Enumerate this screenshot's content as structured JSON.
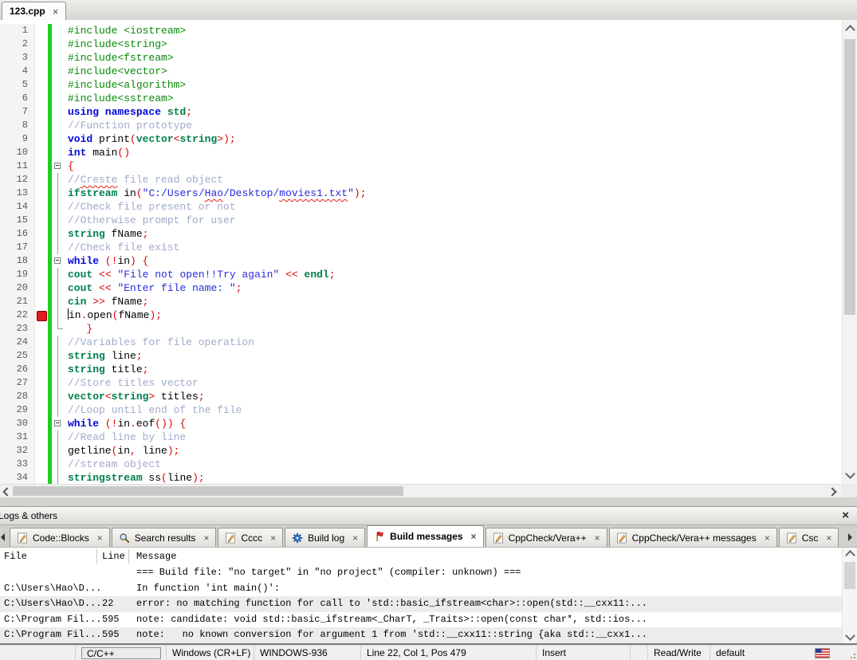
{
  "glyphs": {
    "close": "×"
  },
  "colors": {
    "changebar_green": "#1fcd1f",
    "breakpoint_red": "#e41b1b",
    "keyword_blue": "#0008d7",
    "stdlib_green": "#00804b",
    "preprocessor_green": "#078907",
    "string_blue": "#2a2adf",
    "operator_red": "#de0000",
    "comment_gray_blue": "#9fabcb"
  },
  "editor": {
    "tab": {
      "label": "123.cpp"
    },
    "lines": [
      {
        "n": 1,
        "s": [
          [
            "pp",
            "#include <iostream>"
          ]
        ]
      },
      {
        "n": 2,
        "s": [
          [
            "pp",
            "#include<string>"
          ]
        ]
      },
      {
        "n": 3,
        "s": [
          [
            "pp",
            "#include<fstream>"
          ]
        ]
      },
      {
        "n": 4,
        "s": [
          [
            "pp",
            "#include<vector>"
          ]
        ]
      },
      {
        "n": 5,
        "s": [
          [
            "pp",
            "#include<algorithm>"
          ]
        ]
      },
      {
        "n": 6,
        "s": [
          [
            "pp",
            "#include<sstream>"
          ]
        ]
      },
      {
        "n": 7,
        "s": [
          [
            "kw",
            "using namespace"
          ],
          [
            "id",
            " "
          ],
          [
            "lib",
            "std"
          ],
          [
            "op",
            ";"
          ]
        ]
      },
      {
        "n": 8,
        "s": [
          [
            "com",
            "//Function prototype"
          ]
        ]
      },
      {
        "n": 9,
        "s": [
          [
            "kw",
            "void"
          ],
          [
            "id",
            " print"
          ],
          [
            "op",
            "("
          ],
          [
            "lib",
            "vector"
          ],
          [
            "op",
            "<"
          ],
          [
            "lib",
            "string"
          ],
          [
            "op",
            ">);"
          ]
        ]
      },
      {
        "n": 10,
        "s": [
          [
            "kw",
            "int"
          ],
          [
            "id",
            " main"
          ],
          [
            "op",
            "()"
          ]
        ]
      },
      {
        "n": 11,
        "fold": "box",
        "s": [
          [
            "op",
            "{"
          ]
        ]
      },
      {
        "n": 12,
        "fold": "line",
        "s": [
          [
            "com",
            "//"
          ],
          [
            "com sq",
            "Creste"
          ],
          [
            "com",
            " file read object"
          ]
        ]
      },
      {
        "n": 13,
        "fold": "line",
        "s": [
          [
            "lib",
            "ifstream"
          ],
          [
            "id",
            " in"
          ],
          [
            "op",
            "("
          ],
          [
            "str",
            "\"C:/Users/"
          ],
          [
            "str sq",
            "Hao"
          ],
          [
            "str",
            "/Desktop/"
          ],
          [
            "str sq",
            "movies1.txt"
          ],
          [
            "str",
            "\""
          ],
          [
            "op",
            ");"
          ]
        ]
      },
      {
        "n": 14,
        "fold": "line",
        "s": [
          [
            "com",
            "//Check file present or not"
          ]
        ]
      },
      {
        "n": 15,
        "fold": "line",
        "s": [
          [
            "com",
            "//Otherwise prompt for user"
          ]
        ]
      },
      {
        "n": 16,
        "fold": "line",
        "s": [
          [
            "lib",
            "string"
          ],
          [
            "id",
            " fName"
          ],
          [
            "op",
            ";"
          ]
        ]
      },
      {
        "n": 17,
        "fold": "line",
        "s": [
          [
            "com",
            "//Check file exist"
          ]
        ]
      },
      {
        "n": 18,
        "fold": "box",
        "s": [
          [
            "kw",
            "while"
          ],
          [
            "id",
            " "
          ],
          [
            "op",
            "(!"
          ],
          [
            "id",
            "in"
          ],
          [
            "op",
            ")"
          ],
          [
            "id",
            " "
          ],
          [
            "op",
            "{"
          ]
        ]
      },
      {
        "n": 19,
        "fold": "line",
        "s": [
          [
            "lib",
            "cout"
          ],
          [
            "id",
            " "
          ],
          [
            "op",
            "<<"
          ],
          [
            "id",
            " "
          ],
          [
            "str",
            "\"File not open!!Try again\""
          ],
          [
            "id",
            " "
          ],
          [
            "op",
            "<<"
          ],
          [
            "id",
            " "
          ],
          [
            "lib",
            "endl"
          ],
          [
            "op",
            ";"
          ]
        ]
      },
      {
        "n": 20,
        "fold": "line",
        "s": [
          [
            "lib",
            "cout"
          ],
          [
            "id",
            " "
          ],
          [
            "op",
            "<<"
          ],
          [
            "id",
            " "
          ],
          [
            "str",
            "\"Enter file name: \""
          ],
          [
            "op",
            ";"
          ]
        ]
      },
      {
        "n": 21,
        "fold": "line",
        "s": [
          [
            "lib",
            "cin"
          ],
          [
            "id",
            " "
          ],
          [
            "op",
            ">>"
          ],
          [
            "id",
            " fName"
          ],
          [
            "op",
            ";"
          ]
        ]
      },
      {
        "n": 22,
        "fold": "line",
        "bp": true,
        "caret": true,
        "s": [
          [
            "id",
            "in"
          ],
          [
            "op",
            "."
          ],
          [
            "id",
            "open"
          ],
          [
            "op",
            "("
          ],
          [
            "id",
            "fName"
          ],
          [
            "op",
            ");"
          ]
        ]
      },
      {
        "n": 23,
        "fold": "end",
        "s": [
          [
            "id",
            "   "
          ],
          [
            "op",
            "}"
          ]
        ]
      },
      {
        "n": 24,
        "fold": "line",
        "s": [
          [
            "com",
            "//Variables for file operation"
          ]
        ]
      },
      {
        "n": 25,
        "fold": "line",
        "s": [
          [
            "lib",
            "string"
          ],
          [
            "id",
            " line"
          ],
          [
            "op",
            ";"
          ]
        ]
      },
      {
        "n": 26,
        "fold": "line",
        "s": [
          [
            "lib",
            "string"
          ],
          [
            "id",
            " title"
          ],
          [
            "op",
            ";"
          ]
        ]
      },
      {
        "n": 27,
        "fold": "line",
        "s": [
          [
            "com",
            "//Store titles vector"
          ]
        ]
      },
      {
        "n": 28,
        "fold": "line",
        "s": [
          [
            "lib",
            "vector"
          ],
          [
            "op",
            "<"
          ],
          [
            "lib",
            "string"
          ],
          [
            "op",
            ">"
          ],
          [
            "id",
            " titles"
          ],
          [
            "op",
            ";"
          ]
        ]
      },
      {
        "n": 29,
        "fold": "line",
        "s": [
          [
            "com",
            "//Loop until end of the file"
          ]
        ]
      },
      {
        "n": 30,
        "fold": "box",
        "s": [
          [
            "kw",
            "while"
          ],
          [
            "id",
            " "
          ],
          [
            "op",
            "(!"
          ],
          [
            "id",
            "in"
          ],
          [
            "op",
            "."
          ],
          [
            "id",
            "eof"
          ],
          [
            "op",
            "())"
          ],
          [
            "id",
            " "
          ],
          [
            "op",
            "{"
          ]
        ]
      },
      {
        "n": 31,
        "fold": "line",
        "s": [
          [
            "com",
            "//Read line by line"
          ]
        ]
      },
      {
        "n": 32,
        "fold": "line",
        "s": [
          [
            "id",
            "getline"
          ],
          [
            "op",
            "("
          ],
          [
            "id",
            "in"
          ],
          [
            "op",
            ","
          ],
          [
            "id",
            " line"
          ],
          [
            "op",
            ");"
          ]
        ]
      },
      {
        "n": 33,
        "fold": "line",
        "s": [
          [
            "com",
            "//stream object"
          ]
        ]
      },
      {
        "n": 34,
        "fold": "line",
        "s": [
          [
            "lib",
            "stringstream"
          ],
          [
            "id",
            " ss"
          ],
          [
            "op",
            "("
          ],
          [
            "id",
            "line"
          ],
          [
            "op",
            ");"
          ]
        ]
      }
    ]
  },
  "logs": {
    "caption": "Logs & others",
    "tabs": [
      {
        "label": "Code::Blocks",
        "icon": "report-icon",
        "active": false
      },
      {
        "label": "Search results",
        "icon": "search-icon",
        "active": false
      },
      {
        "label": "Cccc",
        "icon": "report-icon",
        "active": false
      },
      {
        "label": "Build log",
        "icon": "gear-icon",
        "active": false
      },
      {
        "label": "Build messages",
        "icon": "flag-icon",
        "active": true
      },
      {
        "label": "CppCheck/Vera++",
        "icon": "report-icon",
        "active": false
      },
      {
        "label": "CppCheck/Vera++ messages",
        "icon": "report-icon",
        "active": false
      },
      {
        "label": "Csc",
        "icon": "report-icon",
        "active": false
      }
    ],
    "table": {
      "headers": [
        "File",
        "Line",
        "Message"
      ],
      "rows": [
        {
          "file": "",
          "line": "",
          "message": "=== Build file: \"no target\" in \"no project\" (compiler: unknown) ===",
          "shaded": false
        },
        {
          "file": "C:\\Users\\Hao\\D...",
          "line": "",
          "message": "In function 'int main()':",
          "shaded": false
        },
        {
          "file": "C:\\Users\\Hao\\D...",
          "line": "22",
          "message": "error: no matching function for call to 'std::basic_ifstream<char>::open(std::__cxx11:...",
          "shaded": true
        },
        {
          "file": "C:\\Program Fil...",
          "line": "595",
          "message": "note: candidate: void std::basic_ifstream<_CharT, _Traits>::open(const char*, std::ios...",
          "shaded": false
        },
        {
          "file": "C:\\Program Fil...",
          "line": "595",
          "message": "note:   no known conversion for argument 1 from 'std::__cxx11::string {aka std::__cxx1...",
          "shaded": true
        }
      ]
    }
  },
  "statusbar": {
    "fields": [
      {
        "label": ""
      },
      {
        "label": "C/C++",
        "box": true
      },
      {
        "label": "Windows (CR+LF)"
      },
      {
        "label": "WINDOWS-936"
      },
      {
        "label": "Line 22, Col 1, Pos 479"
      },
      {
        "label": "Insert"
      },
      {
        "label": ""
      },
      {
        "label": "Read/Write"
      },
      {
        "label": "default"
      }
    ]
  }
}
